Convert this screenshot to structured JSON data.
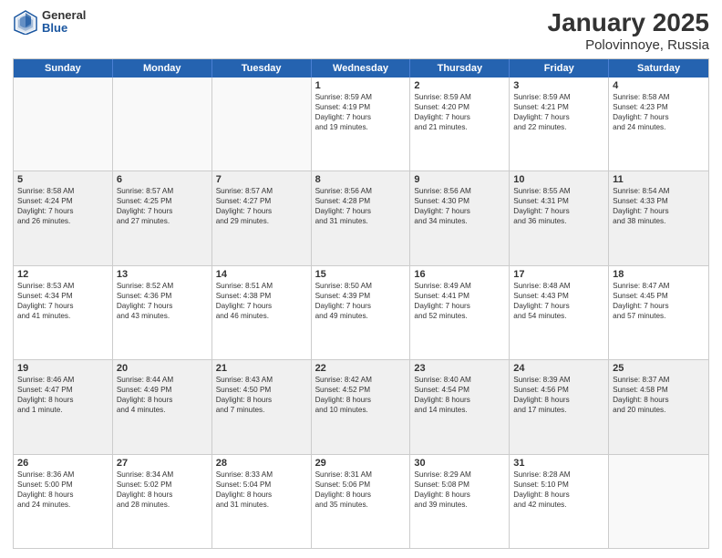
{
  "logo": {
    "general": "General",
    "blue": "Blue"
  },
  "title": "January 2025",
  "subtitle": "Polovinnoye, Russia",
  "days": [
    "Sunday",
    "Monday",
    "Tuesday",
    "Wednesday",
    "Thursday",
    "Friday",
    "Saturday"
  ],
  "weeks": [
    [
      {
        "day": "",
        "lines": [],
        "empty": true
      },
      {
        "day": "",
        "lines": [],
        "empty": true
      },
      {
        "day": "",
        "lines": [],
        "empty": true
      },
      {
        "day": "1",
        "lines": [
          "Sunrise: 8:59 AM",
          "Sunset: 4:19 PM",
          "Daylight: 7 hours",
          "and 19 minutes."
        ]
      },
      {
        "day": "2",
        "lines": [
          "Sunrise: 8:59 AM",
          "Sunset: 4:20 PM",
          "Daylight: 7 hours",
          "and 21 minutes."
        ]
      },
      {
        "day": "3",
        "lines": [
          "Sunrise: 8:59 AM",
          "Sunset: 4:21 PM",
          "Daylight: 7 hours",
          "and 22 minutes."
        ]
      },
      {
        "day": "4",
        "lines": [
          "Sunrise: 8:58 AM",
          "Sunset: 4:23 PM",
          "Daylight: 7 hours",
          "and 24 minutes."
        ]
      }
    ],
    [
      {
        "day": "5",
        "lines": [
          "Sunrise: 8:58 AM",
          "Sunset: 4:24 PM",
          "Daylight: 7 hours",
          "and 26 minutes."
        ],
        "shaded": true
      },
      {
        "day": "6",
        "lines": [
          "Sunrise: 8:57 AM",
          "Sunset: 4:25 PM",
          "Daylight: 7 hours",
          "and 27 minutes."
        ],
        "shaded": true
      },
      {
        "day": "7",
        "lines": [
          "Sunrise: 8:57 AM",
          "Sunset: 4:27 PM",
          "Daylight: 7 hours",
          "and 29 minutes."
        ],
        "shaded": true
      },
      {
        "day": "8",
        "lines": [
          "Sunrise: 8:56 AM",
          "Sunset: 4:28 PM",
          "Daylight: 7 hours",
          "and 31 minutes."
        ],
        "shaded": true
      },
      {
        "day": "9",
        "lines": [
          "Sunrise: 8:56 AM",
          "Sunset: 4:30 PM",
          "Daylight: 7 hours",
          "and 34 minutes."
        ],
        "shaded": true
      },
      {
        "day": "10",
        "lines": [
          "Sunrise: 8:55 AM",
          "Sunset: 4:31 PM",
          "Daylight: 7 hours",
          "and 36 minutes."
        ],
        "shaded": true
      },
      {
        "day": "11",
        "lines": [
          "Sunrise: 8:54 AM",
          "Sunset: 4:33 PM",
          "Daylight: 7 hours",
          "and 38 minutes."
        ],
        "shaded": true
      }
    ],
    [
      {
        "day": "12",
        "lines": [
          "Sunrise: 8:53 AM",
          "Sunset: 4:34 PM",
          "Daylight: 7 hours",
          "and 41 minutes."
        ]
      },
      {
        "day": "13",
        "lines": [
          "Sunrise: 8:52 AM",
          "Sunset: 4:36 PM",
          "Daylight: 7 hours",
          "and 43 minutes."
        ]
      },
      {
        "day": "14",
        "lines": [
          "Sunrise: 8:51 AM",
          "Sunset: 4:38 PM",
          "Daylight: 7 hours",
          "and 46 minutes."
        ]
      },
      {
        "day": "15",
        "lines": [
          "Sunrise: 8:50 AM",
          "Sunset: 4:39 PM",
          "Daylight: 7 hours",
          "and 49 minutes."
        ]
      },
      {
        "day": "16",
        "lines": [
          "Sunrise: 8:49 AM",
          "Sunset: 4:41 PM",
          "Daylight: 7 hours",
          "and 52 minutes."
        ]
      },
      {
        "day": "17",
        "lines": [
          "Sunrise: 8:48 AM",
          "Sunset: 4:43 PM",
          "Daylight: 7 hours",
          "and 54 minutes."
        ]
      },
      {
        "day": "18",
        "lines": [
          "Sunrise: 8:47 AM",
          "Sunset: 4:45 PM",
          "Daylight: 7 hours",
          "and 57 minutes."
        ]
      }
    ],
    [
      {
        "day": "19",
        "lines": [
          "Sunrise: 8:46 AM",
          "Sunset: 4:47 PM",
          "Daylight: 8 hours",
          "and 1 minute."
        ],
        "shaded": true
      },
      {
        "day": "20",
        "lines": [
          "Sunrise: 8:44 AM",
          "Sunset: 4:49 PM",
          "Daylight: 8 hours",
          "and 4 minutes."
        ],
        "shaded": true
      },
      {
        "day": "21",
        "lines": [
          "Sunrise: 8:43 AM",
          "Sunset: 4:50 PM",
          "Daylight: 8 hours",
          "and 7 minutes."
        ],
        "shaded": true
      },
      {
        "day": "22",
        "lines": [
          "Sunrise: 8:42 AM",
          "Sunset: 4:52 PM",
          "Daylight: 8 hours",
          "and 10 minutes."
        ],
        "shaded": true
      },
      {
        "day": "23",
        "lines": [
          "Sunrise: 8:40 AM",
          "Sunset: 4:54 PM",
          "Daylight: 8 hours",
          "and 14 minutes."
        ],
        "shaded": true
      },
      {
        "day": "24",
        "lines": [
          "Sunrise: 8:39 AM",
          "Sunset: 4:56 PM",
          "Daylight: 8 hours",
          "and 17 minutes."
        ],
        "shaded": true
      },
      {
        "day": "25",
        "lines": [
          "Sunrise: 8:37 AM",
          "Sunset: 4:58 PM",
          "Daylight: 8 hours",
          "and 20 minutes."
        ],
        "shaded": true
      }
    ],
    [
      {
        "day": "26",
        "lines": [
          "Sunrise: 8:36 AM",
          "Sunset: 5:00 PM",
          "Daylight: 8 hours",
          "and 24 minutes."
        ]
      },
      {
        "day": "27",
        "lines": [
          "Sunrise: 8:34 AM",
          "Sunset: 5:02 PM",
          "Daylight: 8 hours",
          "and 28 minutes."
        ]
      },
      {
        "day": "28",
        "lines": [
          "Sunrise: 8:33 AM",
          "Sunset: 5:04 PM",
          "Daylight: 8 hours",
          "and 31 minutes."
        ]
      },
      {
        "day": "29",
        "lines": [
          "Sunrise: 8:31 AM",
          "Sunset: 5:06 PM",
          "Daylight: 8 hours",
          "and 35 minutes."
        ]
      },
      {
        "day": "30",
        "lines": [
          "Sunrise: 8:29 AM",
          "Sunset: 5:08 PM",
          "Daylight: 8 hours",
          "and 39 minutes."
        ]
      },
      {
        "day": "31",
        "lines": [
          "Sunrise: 8:28 AM",
          "Sunset: 5:10 PM",
          "Daylight: 8 hours",
          "and 42 minutes."
        ]
      },
      {
        "day": "",
        "lines": [],
        "empty": true
      }
    ]
  ]
}
